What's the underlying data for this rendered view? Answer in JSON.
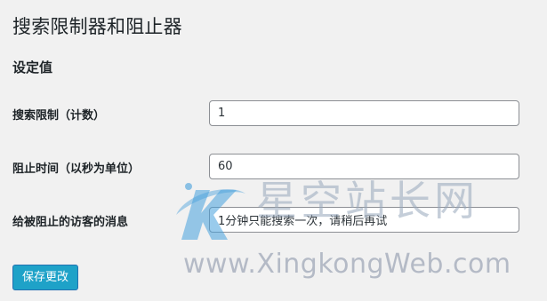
{
  "header": {
    "title": "搜索限制器和阻止器"
  },
  "settings": {
    "section_title": "设定值",
    "fields": [
      {
        "label": "搜索限制（计数）",
        "value": "1"
      },
      {
        "label": "阻止时间（以秒为单位）",
        "value": "60"
      },
      {
        "label": "给被阻止的访客的消息",
        "value": "1分钟只能搜索一次，请稍后再试"
      }
    ]
  },
  "actions": {
    "save_label": "保存更改"
  },
  "watermark": {
    "brand": "星空站长网",
    "url": "www.XingkongWeb.com"
  },
  "colors": {
    "background": "#f1f1f1",
    "button": "#1ea2c8",
    "input_border": "#8c8f94"
  }
}
